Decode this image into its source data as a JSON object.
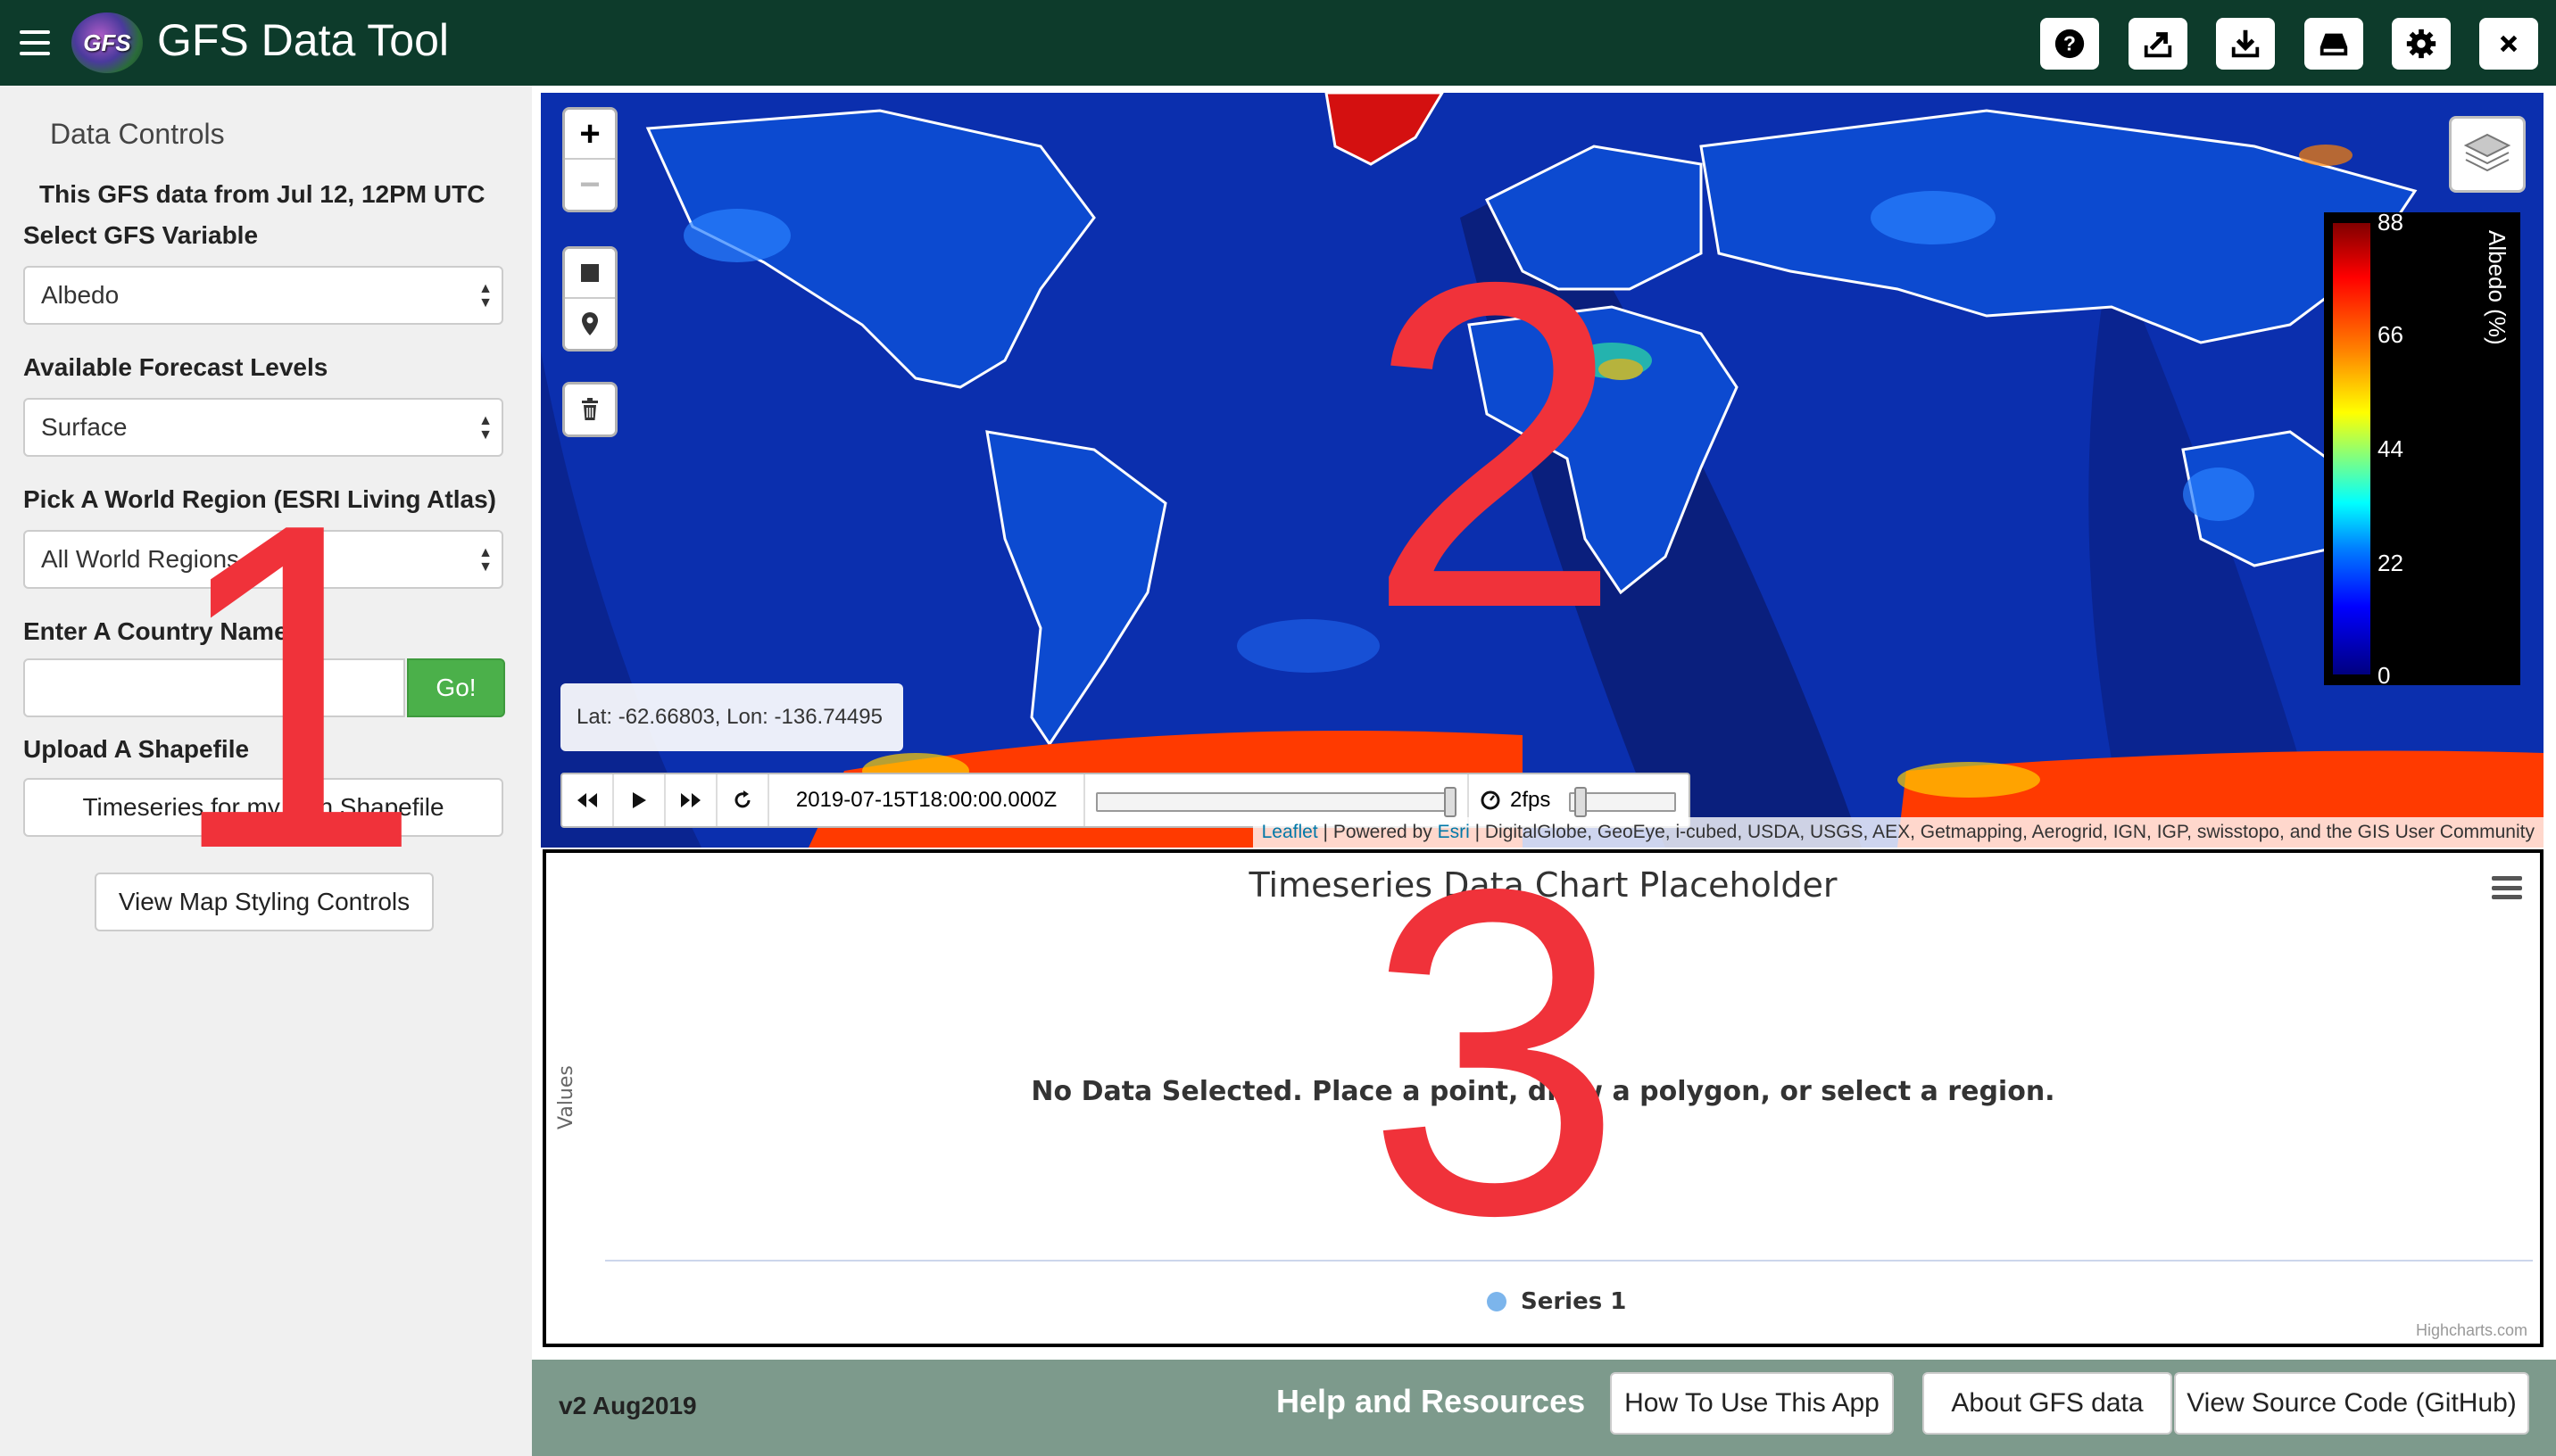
{
  "app": {
    "title": "GFS Data Tool",
    "logo_text": "GFS"
  },
  "toolbar": {
    "icons": [
      "help-icon",
      "export-icon",
      "download-icon",
      "drive-icon",
      "gear-icon",
      "close-icon"
    ]
  },
  "left_panel": {
    "title": "Data Controls",
    "data_date": "This GFS data from Jul 12, 12PM UTC",
    "variable_label": "Select GFS Variable",
    "variable_value": "Albedo",
    "levels_label": "Available Forecast Levels",
    "levels_value": "Surface",
    "region_label": "Pick A World Region (ESRI Living Atlas)",
    "region_value": "All World Regions",
    "country_label": "Enter A Country Name",
    "country_value": "",
    "go_label": "Go!",
    "shapefile_label": "Upload A Shapefile",
    "shapefile_button": "Timeseries for my own Shapefile",
    "styling_button": "View Map Styling Controls"
  },
  "map": {
    "zoom_in": "+",
    "zoom_out": "−",
    "latlon": "Lat: -62.66803, Lon: -136.74495",
    "timestamp": "2019-07-15T18:00:00.000Z",
    "fps": "2fps",
    "legend": {
      "title": "Albedo (%)",
      "ticks": [
        "88",
        "66",
        "44",
        "22",
        "0"
      ]
    },
    "attribution": {
      "leaflet": "Leaflet",
      "powered": "| Powered by",
      "esri": "Esri",
      "rest": "| DigitalGlobe, GeoEye, i-cubed, USDA, USGS, AEX, Getmapping, Aerogrid, IGN, IGP, swisstopo, and the GIS User Community"
    }
  },
  "chart": {
    "title": "Timeseries Data Chart Placeholder",
    "y_label": "Values",
    "no_data": "No Data Selected. Place a point, draw a polygon, or select a region.",
    "series_name": "Series 1",
    "credits": "Highcharts.com"
  },
  "chart_data": {
    "type": "line",
    "title": "Timeseries Data Chart Placeholder",
    "xlabel": "",
    "ylabel": "Values",
    "series": [
      {
        "name": "Series 1",
        "values": []
      }
    ],
    "legend": "bottom-center",
    "grid": false
  },
  "footer": {
    "version": "v2 Aug2019",
    "help_title": "Help and Resources",
    "how_to": "How To Use This App",
    "about": "About GFS data",
    "source": "View Source Code (GitHub)"
  },
  "overlay_numbers": [
    "1",
    "2",
    "3"
  ],
  "colors": {
    "topbar": "#0d3b2b",
    "footer": "#7d9a8c",
    "go_button": "#4bb04a",
    "overlay": "#f0323a",
    "ocean": "#0a2da8",
    "series": "#7cb5ec"
  }
}
